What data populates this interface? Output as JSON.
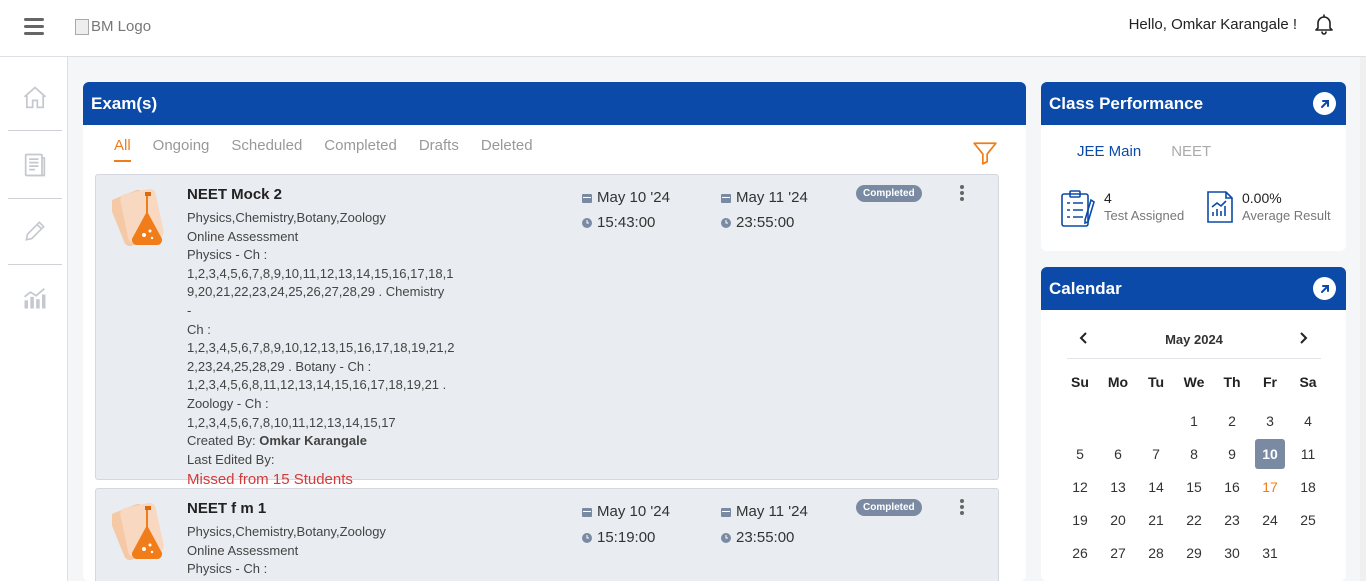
{
  "header": {
    "logo_alt": "BM Logo",
    "greeting": "Hello, Omkar Karangale !"
  },
  "sidebar": {
    "items": [
      {
        "icon": "home-icon"
      },
      {
        "icon": "document-icon"
      },
      {
        "icon": "pencil-icon"
      },
      {
        "icon": "chart-icon"
      }
    ]
  },
  "exams": {
    "title": "Exam(s)",
    "tabs": [
      "All",
      "Ongoing",
      "Scheduled",
      "Completed",
      "Drafts",
      "Deleted"
    ],
    "active_tab": "All",
    "cards": [
      {
        "title": "NEET Mock 2",
        "subjects": "Physics,Chemistry,Botany,Zoology",
        "type": "Online Assessment",
        "chapters": [
          "Physics - Ch :",
          "1,2,3,4,5,6,7,8,9,10,11,12,13,14,15,16,17,18,1",
          "9,20,21,22,23,24,25,26,27,28,29 . Chemistry -",
          "Ch :",
          "1,2,3,4,5,6,7,8,9,10,12,13,15,16,17,18,19,21,2",
          "2,23,24,25,28,29 . Botany - Ch :",
          "1,2,3,4,5,6,8,11,12,13,14,15,16,17,18,19,21 .",
          "Zoology - Ch :",
          "1,2,3,4,5,6,7,8,10,11,12,13,14,15,17"
        ],
        "created_by_label": "Created By: ",
        "created_by": "Omkar Karangale",
        "last_edited_label": "Last Edited By:",
        "missed": "Missed from 15 Students",
        "start_date": "May 10 '24",
        "start_time": "15:43:00",
        "end_date": "May 11 '24",
        "end_time": "23:55:00",
        "status": "Completed"
      },
      {
        "title": "NEET f m 1",
        "subjects": "Physics,Chemistry,Botany,Zoology",
        "type": "Online Assessment",
        "chapters": [
          "Physics - Ch :"
        ],
        "start_date": "May 10 '24",
        "start_time": "15:19:00",
        "end_date": "May 11 '24",
        "end_time": "23:55:00",
        "status": "Completed"
      }
    ]
  },
  "performance": {
    "title": "Class Performance",
    "tabs": [
      "JEE Main",
      "NEET"
    ],
    "active_tab": "JEE Main",
    "tests_assigned": "4",
    "tests_assigned_label": "Test Assigned",
    "average_result": "0.00%",
    "average_result_label": "Average Result"
  },
  "calendar": {
    "title": "Calendar",
    "month": "May 2024",
    "weekdays": [
      "Su",
      "Mo",
      "Tu",
      "We",
      "Th",
      "Fr",
      "Sa"
    ],
    "leading_blanks": 3,
    "days": [
      "1",
      "2",
      "3",
      "4",
      "5",
      "6",
      "7",
      "8",
      "9",
      "10",
      "11",
      "12",
      "13",
      "14",
      "15",
      "16",
      "17",
      "18",
      "19",
      "20",
      "21",
      "22",
      "23",
      "24",
      "25",
      "26",
      "27",
      "28",
      "29",
      "30",
      "31"
    ],
    "selected_day": "10",
    "today": "17"
  },
  "colors": {
    "primary": "#0b4aa8",
    "accent": "#f07d1a",
    "badge": "#7a8aa3",
    "danger": "#d33a3a"
  }
}
